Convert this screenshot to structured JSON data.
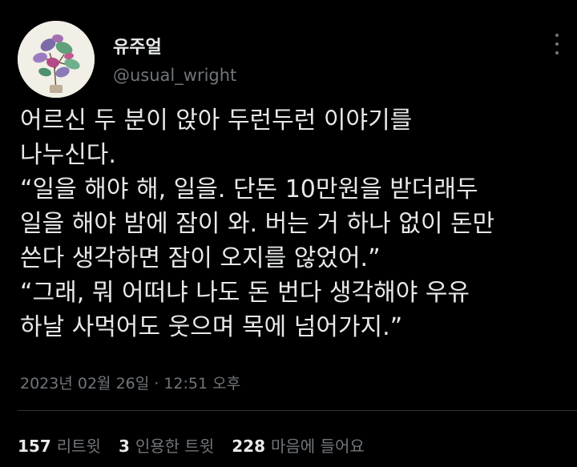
{
  "user": {
    "display_name": "유주얼",
    "handle": "@usual_wright",
    "avatar_icon": "plant-leaves-avatar"
  },
  "tweet": {
    "lines": [
      "어르신 두 분이 앉아 두런두런 이야기를",
      "나누신다.",
      "“일을 해야 해, 일을. 단돈 10만원을 받더래두",
      "일을 해야 밤에 잠이 와. 버는 거 하나 없이 돈만",
      "쓴다 생각하면 잠이 오지를 않었어.”",
      "“그래, 뭐 어떠냐 나도 돈 번다 생각해야 우유",
      "하날 사먹어도 웃으며 목에 넘어가지.”"
    ],
    "timestamp": "2023년 02월 26일 · 12:51 오후"
  },
  "stats": {
    "retweets": {
      "count": "157",
      "label": "리트윗"
    },
    "quotes": {
      "count": "3",
      "label": "인용한 트윗"
    },
    "likes": {
      "count": "228",
      "label": "마음에 들어요"
    }
  },
  "colors": {
    "background": "#000000",
    "primary_text": "#e7e9ea",
    "secondary_text": "#71767b",
    "divider": "#2f3336"
  }
}
